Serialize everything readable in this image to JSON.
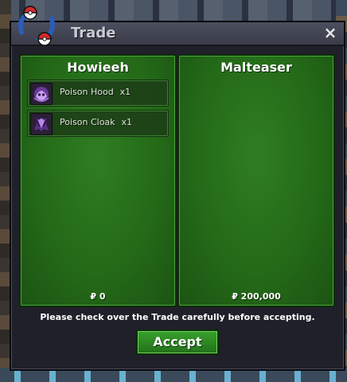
{
  "window": {
    "title": "Trade",
    "close_symbol": "×",
    "notice": "Please check over the Trade carefully before accepting.",
    "accept_label": "Accept"
  },
  "left_panel": {
    "player": "Howieeh",
    "items": [
      {
        "name": "Poison Hood",
        "qty": "x1",
        "icon": "poison-hood-icon"
      },
      {
        "name": "Poison Cloak",
        "qty": "x1",
        "icon": "poison-cloak-icon"
      }
    ],
    "money": "₽ 0"
  },
  "right_panel": {
    "player": "Malteaser",
    "items": [],
    "money": "₽ 200,000"
  },
  "colors": {
    "panel_green": "#2f7d22",
    "accept_green": "#38a12c",
    "title_text": "#c9cbd4"
  }
}
